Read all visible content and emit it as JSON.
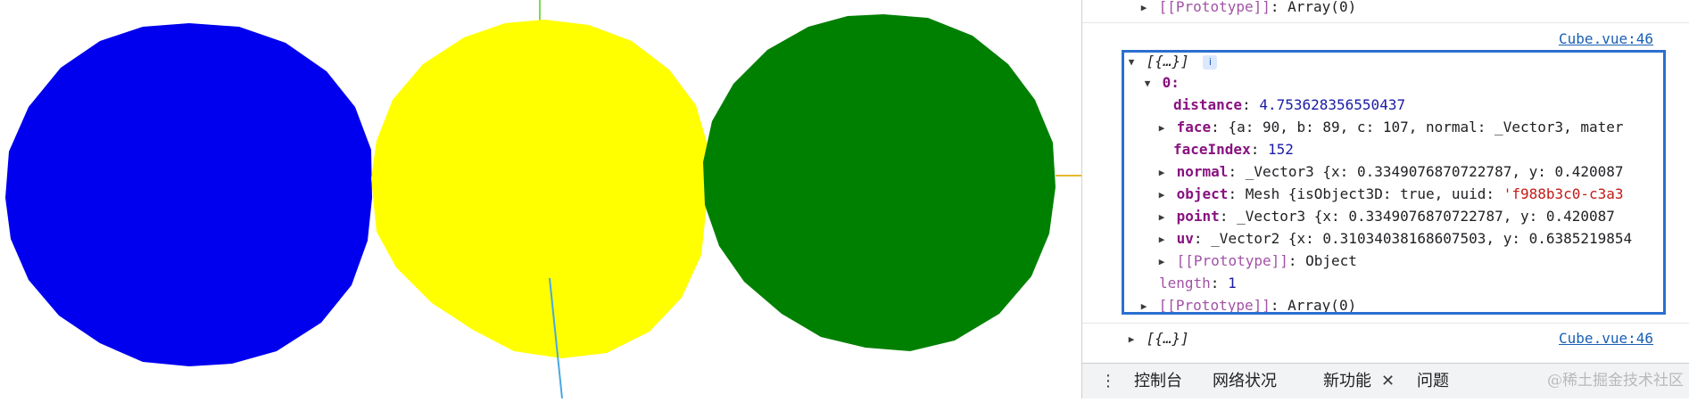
{
  "scene": {
    "colors": {
      "blue_circle": "#0000ee",
      "yellow_circle": "#ffff00",
      "green_circle": "#008000",
      "axis_green": "#7cdc50",
      "axis_blue": "#4aa8e0",
      "axis_orange": "#e8b830"
    }
  },
  "console": {
    "lines": [
      {
        "prefix": "[[Prototype]]",
        "value": "Array(0)"
      },
      {
        "source": "Cube.vue:46"
      },
      {
        "summary": "[{…}]",
        "info_icon": "i"
      },
      {
        "key": "0:"
      },
      {
        "key": "distance",
        "value": "4.753628356550437"
      },
      {
        "key": "face",
        "value_a": "90",
        "value_b": "89",
        "value_c": "107",
        "text": "{a: 90, b: 89, c: 107, normal: _Vector3, mater"
      },
      {
        "key": "faceIndex",
        "value": "152"
      },
      {
        "key": "normal",
        "type": "_Vector3",
        "text": "{x: 0.3349076870722787, y: 0.420087"
      },
      {
        "key": "object",
        "type": "Mesh",
        "text": "{isObject3D: true, uuid: ",
        "uuid": "'f988b3c0-c3a3"
      },
      {
        "key": "point",
        "type": "_Vector3",
        "text": "{x: 0.3349076870722787, y: 0.420087"
      },
      {
        "key": "uv",
        "type": "_Vector2",
        "text": "{x: 0.31034038168607503, y: 0.6385219854"
      },
      {
        "prefix": "[[Prototype]]",
        "value": "Object"
      },
      {
        "key": "length",
        "value": "1"
      },
      {
        "prefix": "[[Prototype]]",
        "value": "Array(0)"
      },
      {
        "summary": "[{…}]",
        "source": "Cube.vue:46"
      }
    ]
  },
  "drawer": {
    "more_icon": "⋮",
    "tabs": [
      "控制台",
      "网络状况",
      "新功能",
      "问题"
    ],
    "close_glyph": "✕",
    "watermark": "@稀土掘金技术社区"
  },
  "colors": {
    "highlight_border": "#2b6fcf",
    "link": "#1a5fb4"
  }
}
